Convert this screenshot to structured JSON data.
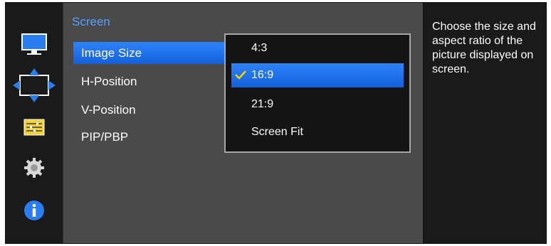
{
  "sidebar": {
    "items": [
      {
        "icon": "monitor-icon"
      },
      {
        "icon": "image-size-arrows-icon"
      },
      {
        "icon": "sliders-icon"
      },
      {
        "icon": "gear-icon"
      },
      {
        "icon": "info-icon"
      }
    ],
    "selected_index": 1
  },
  "menu": {
    "title": "Screen",
    "items": [
      {
        "label": "Image Size",
        "selected": true
      },
      {
        "label": "H-Position",
        "selected": false
      },
      {
        "label": "V-Position",
        "selected": false
      },
      {
        "label": "PIP/PBP",
        "selected": false
      }
    ]
  },
  "dropdown": {
    "options": [
      {
        "label": "4:3",
        "selected": false
      },
      {
        "label": "16:9",
        "selected": true
      },
      {
        "label": "21:9",
        "selected": false
      },
      {
        "label": "Screen Fit",
        "selected": false
      }
    ]
  },
  "description": {
    "text": "Choose the size and aspect ratio of the picture displayed on screen."
  },
  "colors": {
    "accent": "#1f6fe8",
    "title": "#5aa0ff",
    "check": "#f0d400",
    "panel": "#4a4a4a",
    "background": "#1a1a1a"
  }
}
